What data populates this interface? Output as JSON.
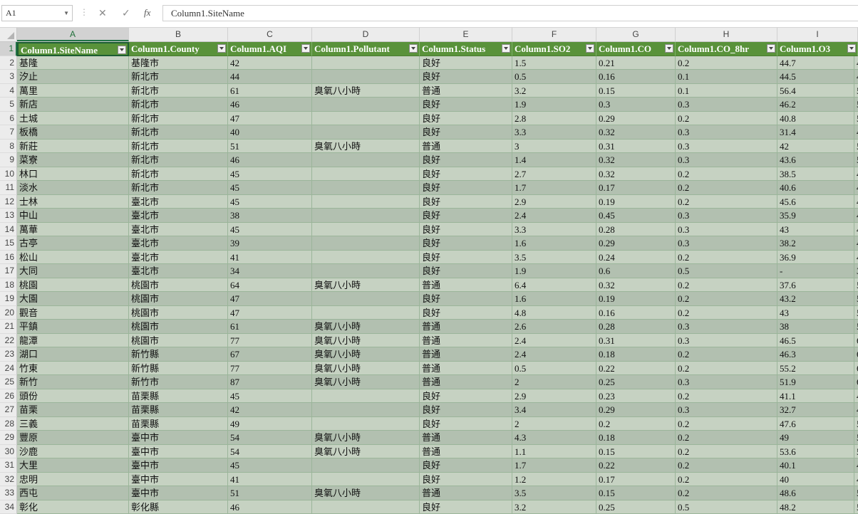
{
  "formula_bar": {
    "name_box": "A1",
    "cancel_icon": "✕",
    "enter_icon": "✓",
    "fx_label": "fx",
    "formula": "Column1.SiteName"
  },
  "column_letters": [
    "A",
    "B",
    "C",
    "D",
    "E",
    "F",
    "G",
    "H",
    "I"
  ],
  "header": [
    "Column1.SiteName",
    "Column1.County",
    "Column1.AQI",
    "Column1.Pollutant",
    "Column1.Status",
    "Column1.SO2",
    "Column1.CO",
    "Column1.CO_8hr",
    "Column1.O3"
  ],
  "rows": [
    [
      "2",
      "基隆",
      "基隆市",
      "42",
      "",
      "良好",
      "1.5",
      "0.21",
      "0.2",
      "44.7",
      "4"
    ],
    [
      "3",
      "汐止",
      "新北市",
      "44",
      "",
      "良好",
      "0.5",
      "0.16",
      "0.1",
      "44.5",
      "4"
    ],
    [
      "4",
      "萬里",
      "新北市",
      "61",
      "臭氧八小時",
      "普通",
      "3.2",
      "0.15",
      "0.1",
      "56.4",
      "5"
    ],
    [
      "5",
      "新店",
      "新北市",
      "46",
      "",
      "良好",
      "1.9",
      "0.3",
      "0.3",
      "46.2",
      "5"
    ],
    [
      "6",
      "土城",
      "新北市",
      "47",
      "",
      "良好",
      "2.8",
      "0.29",
      "0.2",
      "40.8",
      "5"
    ],
    [
      "7",
      "板橋",
      "新北市",
      "40",
      "",
      "良好",
      "3.3",
      "0.32",
      "0.3",
      "31.4",
      "4"
    ],
    [
      "8",
      "新莊",
      "新北市",
      "51",
      "臭氧八小時",
      "普通",
      "3",
      "0.31",
      "0.3",
      "42",
      "5"
    ],
    [
      "9",
      "菜寮",
      "新北市",
      "46",
      "",
      "良好",
      "1.4",
      "0.32",
      "0.3",
      "43.6",
      "5"
    ],
    [
      "10",
      "林口",
      "新北市",
      "45",
      "",
      "良好",
      "2.7",
      "0.32",
      "0.2",
      "38.5",
      "4"
    ],
    [
      "11",
      "淡水",
      "新北市",
      "45",
      "",
      "良好",
      "1.7",
      "0.17",
      "0.2",
      "40.6",
      "4"
    ],
    [
      "12",
      "士林",
      "臺北市",
      "45",
      "",
      "良好",
      "2.9",
      "0.19",
      "0.2",
      "45.6",
      "4"
    ],
    [
      "13",
      "中山",
      "臺北市",
      "38",
      "",
      "良好",
      "2.4",
      "0.45",
      "0.3",
      "35.9",
      "4"
    ],
    [
      "14",
      "萬華",
      "臺北市",
      "45",
      "",
      "良好",
      "3.3",
      "0.28",
      "0.3",
      "43",
      "4"
    ],
    [
      "15",
      "古亭",
      "臺北市",
      "39",
      "",
      "良好",
      "1.6",
      "0.29",
      "0.3",
      "38.2",
      "4"
    ],
    [
      "16",
      "松山",
      "臺北市",
      "41",
      "",
      "良好",
      "3.5",
      "0.24",
      "0.2",
      "36.9",
      "4"
    ],
    [
      "17",
      "大同",
      "臺北市",
      "34",
      "",
      "良好",
      "1.9",
      "0.6",
      "0.5",
      "-",
      "3"
    ],
    [
      "18",
      "桃園",
      "桃園市",
      "64",
      "臭氧八小時",
      "普通",
      "6.4",
      "0.32",
      "0.2",
      "37.6",
      "5"
    ],
    [
      "19",
      "大園",
      "桃園市",
      "47",
      "",
      "良好",
      "1.6",
      "0.19",
      "0.2",
      "43.2",
      "5"
    ],
    [
      "20",
      "觀音",
      "桃園市",
      "47",
      "",
      "良好",
      "4.8",
      "0.16",
      "0.2",
      "43",
      "5"
    ],
    [
      "21",
      "平鎮",
      "桃園市",
      "61",
      "臭氧八小時",
      "普通",
      "2.6",
      "0.28",
      "0.3",
      "38",
      "5"
    ],
    [
      "22",
      "龍潭",
      "桃園市",
      "77",
      "臭氧八小時",
      "普通",
      "2.4",
      "0.31",
      "0.3",
      "46.5",
      "6"
    ],
    [
      "23",
      "湖口",
      "新竹縣",
      "67",
      "臭氧八小時",
      "普通",
      "2.4",
      "0.18",
      "0.2",
      "46.3",
      "6"
    ],
    [
      "24",
      "竹東",
      "新竹縣",
      "77",
      "臭氧八小時",
      "普通",
      "0.5",
      "0.22",
      "0.2",
      "55.2",
      "6"
    ],
    [
      "25",
      "新竹",
      "新竹市",
      "87",
      "臭氧八小時",
      "普通",
      "2",
      "0.25",
      "0.3",
      "51.9",
      "6"
    ],
    [
      "26",
      "頭份",
      "苗栗縣",
      "45",
      "",
      "良好",
      "2.9",
      "0.23",
      "0.2",
      "41.1",
      "4"
    ],
    [
      "27",
      "苗栗",
      "苗栗縣",
      "42",
      "",
      "良好",
      "3.4",
      "0.29",
      "0.3",
      "32.7",
      "4"
    ],
    [
      "28",
      "三義",
      "苗栗縣",
      "49",
      "",
      "良好",
      "2",
      "0.2",
      "0.2",
      "47.6",
      "5"
    ],
    [
      "29",
      "豐原",
      "臺中市",
      "54",
      "臭氧八小時",
      "普通",
      "4.3",
      "0.18",
      "0.2",
      "49",
      "5"
    ],
    [
      "30",
      "沙鹿",
      "臺中市",
      "54",
      "臭氧八小時",
      "普通",
      "1.1",
      "0.15",
      "0.2",
      "53.6",
      "5"
    ],
    [
      "31",
      "大里",
      "臺中市",
      "45",
      "",
      "良好",
      "1.7",
      "0.22",
      "0.2",
      "40.1",
      "4"
    ],
    [
      "32",
      "忠明",
      "臺中市",
      "41",
      "",
      "良好",
      "1.2",
      "0.17",
      "0.2",
      "40",
      "4"
    ],
    [
      "33",
      "西屯",
      "臺中市",
      "51",
      "臭氧八小時",
      "普通",
      "3.5",
      "0.15",
      "0.2",
      "48.6",
      "5"
    ],
    [
      "34",
      "彰化",
      "彰化縣",
      "46",
      "",
      "良好",
      "3.2",
      "0.25",
      "0.5",
      "48.2",
      "5"
    ]
  ]
}
